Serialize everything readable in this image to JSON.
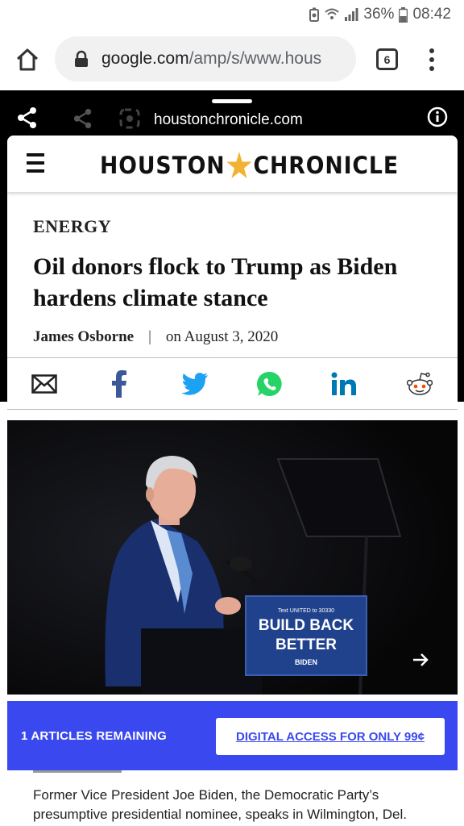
{
  "status_bar": {
    "battery": "36%",
    "time": "08:42"
  },
  "browser": {
    "url_host": "google.com",
    "url_path": "/amp/s/www.hous",
    "tab_count": "6"
  },
  "amp_viewer": {
    "domain": "houstonchronicle.com"
  },
  "site": {
    "masthead_left": "HOUSTON",
    "masthead_right": "CHRONICLE"
  },
  "article": {
    "section": "ENERGY",
    "headline": "Oil donors flock to Trump as Biden hardens climate stance",
    "author": "James Osborne",
    "separator": "|",
    "date": "on August 3, 2020",
    "photo_sign": {
      "small_line": "Text UNITED to 30330",
      "line1": "BUILD BACK",
      "line2": "BETTER",
      "brand": "BIDEN"
    },
    "caption": "Former Vice President Joe Biden, the Democratic Party’s presumptive presidential nominee, speaks in Wilmington, Del."
  },
  "share_icons": [
    "email-icon",
    "facebook-icon",
    "twitter-icon",
    "whatsapp-icon",
    "linkedin-icon",
    "reddit-icon"
  ],
  "paywall": {
    "remaining": "1 ARTICLES REMAINING",
    "cta": "DIGITAL ACCESS FOR ONLY 99¢"
  },
  "colors": {
    "paywall_bg": "#3a48ef",
    "twitter": "#1da1f2",
    "facebook": "#3b5998",
    "whatsapp": "#25d366",
    "linkedin": "#0077b5",
    "star": "#f2b233"
  }
}
